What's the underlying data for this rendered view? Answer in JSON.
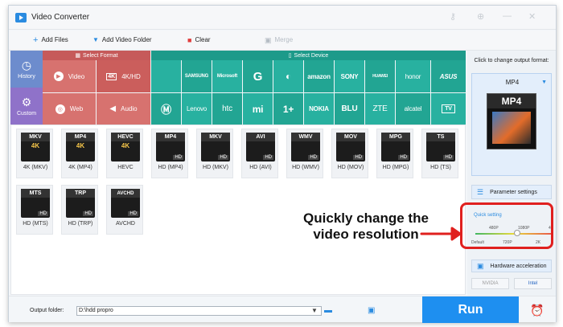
{
  "window": {
    "title": "Video Converter"
  },
  "toolbar": {
    "add_files": "Add Files",
    "add_video_folder": "Add Video Folder",
    "clear": "Clear",
    "merge": "Merge"
  },
  "categories": {
    "history": "History",
    "custom": "Custom",
    "select_format": "Select Format",
    "select_device": "Select Device",
    "formats": [
      "Video",
      "4K/HD",
      "Web",
      "Audio"
    ],
    "devices_row1": [
      "SAMSUNG",
      "Microsoft",
      "amazon",
      "SONY",
      "HUAWEI",
      "honor",
      "ASUS"
    ],
    "devices_row2": [
      "Lenovo",
      "htc",
      "NOKIA",
      "BLU",
      "ZTE",
      "alcatel",
      "TV"
    ]
  },
  "files": [
    {
      "badge": "MKV",
      "mid": "4K",
      "label": "4K (MKV)"
    },
    {
      "badge": "MP4",
      "mid": "4K",
      "label": "4K (MP4)"
    },
    {
      "badge": "HEVC",
      "mid": "4K",
      "label": "HEVC"
    },
    {
      "badge": "MP4",
      "mid": "HD",
      "label": "HD (MP4)"
    },
    {
      "badge": "MKV",
      "mid": "HD",
      "label": "HD (MKV)"
    },
    {
      "badge": "AVI",
      "mid": "HD",
      "label": "HD (AVI)"
    },
    {
      "badge": "WMV",
      "mid": "HD",
      "label": "HD (WMV)"
    },
    {
      "badge": "MOV",
      "mid": "HD",
      "label": "HD (MOV)"
    },
    {
      "badge": "MPG",
      "mid": "HD",
      "label": "HD (MPG)"
    },
    {
      "badge": "TS",
      "mid": "HD",
      "label": "HD (TS)"
    },
    {
      "badge": "MTS",
      "mid": "HD",
      "label": "HD (MTS)"
    },
    {
      "badge": "TRP",
      "mid": "HD",
      "label": "HD (TRP)"
    },
    {
      "badge": "AVCHD",
      "mid": "HD",
      "label": "AVCHD"
    }
  ],
  "bottom": {
    "output_folder_label": "Output folder:",
    "output_folder_value": "D:\\hdd propro",
    "run": "Run"
  },
  "right_panel": {
    "hint": "Click to change output format:",
    "output_format": "MP4",
    "parameter_settings": "Parameter settings",
    "quick_setting": "Quick setting",
    "res_top": [
      "480P",
      "1080P",
      "4K"
    ],
    "res_bottom": [
      "Default",
      "720P",
      "2K"
    ],
    "quality_level": 0.55,
    "hardware_acceleration": "Hardware acceleration",
    "chips": [
      "NVIDIA",
      "Intel"
    ]
  },
  "annotation": {
    "line1": "Quickly change the",
    "line2": "video resolution"
  },
  "colors": {
    "accent": "#1e8ff0",
    "annotation": "#e0201e"
  }
}
